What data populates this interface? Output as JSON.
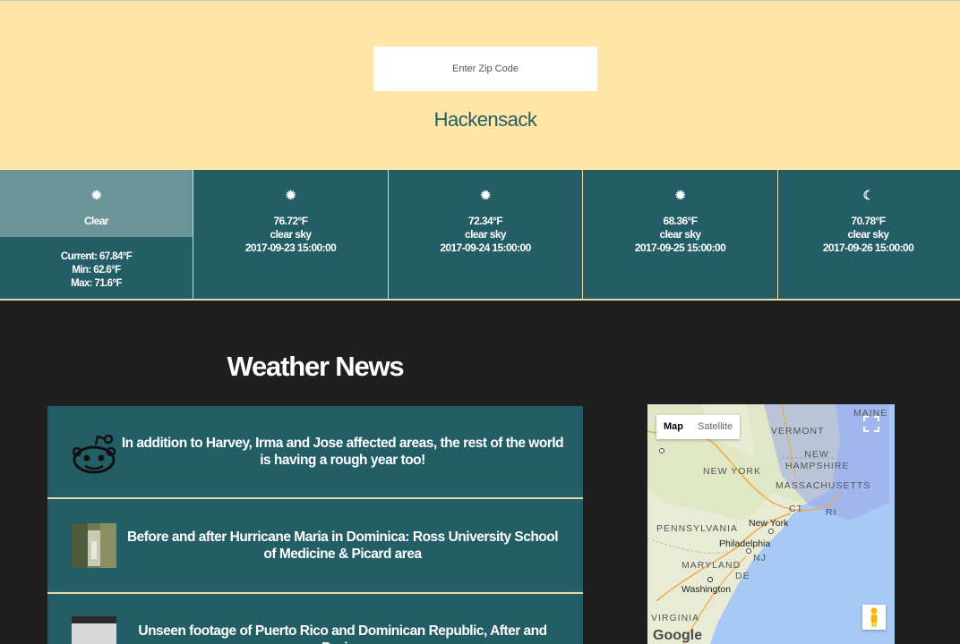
{
  "search": {
    "placeholder": "Enter Zip Code"
  },
  "city": "Hackensack",
  "today": {
    "icon": "sun-icon",
    "description": "Clear",
    "current": "Current: 67.84°F",
    "min": "Min: 62.6°F",
    "max": "Max: 71.6°F"
  },
  "forecast": [
    {
      "icon": "sun-icon",
      "temp": "76.72°F",
      "desc": "clear sky",
      "datetime": "2017-09-23 15:00:00"
    },
    {
      "icon": "sun-icon",
      "temp": "72.34°F",
      "desc": "clear sky",
      "datetime": "2017-09-24 15:00:00"
    },
    {
      "icon": "sun-icon",
      "temp": "68.36°F",
      "desc": "clear sky",
      "datetime": "2017-09-25 15:00:00"
    },
    {
      "icon": "moon-icon",
      "temp": "70.78°F",
      "desc": "clear sky",
      "datetime": "2017-09-26 15:00:00"
    }
  ],
  "news": {
    "title": "Weather News",
    "items": [
      {
        "thumb": "reddit-alien-icon",
        "text": "In addition to Harvey, Irma and Jose affected areas, the rest of the world is having a rough year too!"
      },
      {
        "thumb": "news-photo-thumbnail",
        "text": "Before and after Hurricane Maria in Dominica: Ross University School of Medicine & Picard area"
      },
      {
        "thumb": "news-photo-thumbnail",
        "text": "Unseen footage of Puerto Rico and Dominican Republic, After and During"
      }
    ]
  },
  "map": {
    "map_label": "Map",
    "satellite_label": "Satellite",
    "labels": {
      "vermont": "VERMONT",
      "new_hampshire": "NEW HAMPSHIRE",
      "maine": "MAINE",
      "new_york_state": "NEW YORK",
      "massachusetts": "MASSACHUSETTS",
      "ct": "CT",
      "ri": "RI",
      "new_york_city": "New York",
      "pennsylvania": "PENNSYLVANIA",
      "philadelphia": "Philadelphia",
      "nj": "NJ",
      "maryland": "MARYLAND",
      "de": "DE",
      "washington": "Washington",
      "virginia": "VIRGINIA"
    },
    "attribution": "Google"
  },
  "colors": {
    "header_bg": "#ffe6a6",
    "accent_teal": "#235e66",
    "today_highlight": "#6a949a",
    "divider": "#e9d9a6",
    "page_bg": "#1f1f1f"
  }
}
